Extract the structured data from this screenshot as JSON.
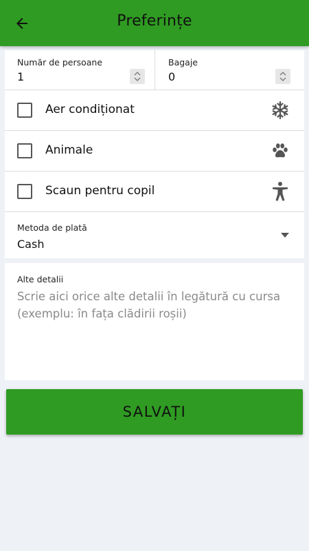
{
  "header": {
    "title": "Preferințe",
    "back_icon": "arrow-left-icon"
  },
  "counts": {
    "persons": {
      "label": "Număr de persoane",
      "value": "1"
    },
    "luggage": {
      "label": "Bagaje",
      "value": "0"
    }
  },
  "options": [
    {
      "label": "Aer condiționat",
      "checked": false,
      "icon": "snowflake-icon"
    },
    {
      "label": "Animale",
      "checked": false,
      "icon": "paw-icon"
    },
    {
      "label": "Scaun pentru copil",
      "checked": false,
      "icon": "accessibility-person-icon"
    }
  ],
  "payment": {
    "label": "Metoda de plată",
    "value": "Cash"
  },
  "details": {
    "label": "Alte detalii",
    "placeholder": "Scrie aici orice alte detalii în legătură cu cursa (exemplu: în fața clădirii roșii)",
    "value": ""
  },
  "save": {
    "label": "SALVAȚI"
  },
  "colors": {
    "primary": "#2f9b22",
    "background": "#eef1f6"
  }
}
